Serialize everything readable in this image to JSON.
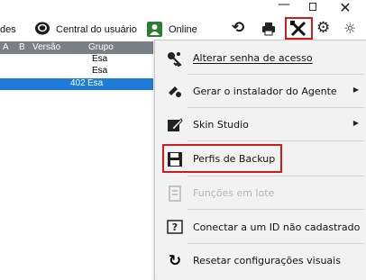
{
  "window": {
    "minimize_glyph": "—",
    "close_glyph": "✕"
  },
  "toolbar": {
    "left_partial_label": "des",
    "central_label": "Central do usuário",
    "online_label": "Online",
    "icons": [
      "chat-icon",
      "online-status-icon",
      "refresh-icon",
      "print-icon",
      "tools-icon",
      "gear-icon",
      "bulb-icon"
    ],
    "highlight_color": "#d11a1a"
  },
  "grid": {
    "columns": [
      "A",
      "B",
      "Versão",
      "Grupo"
    ],
    "rows": [
      {
        "version": "",
        "group": "Esa",
        "selected": false
      },
      {
        "version": "",
        "group": "Esa",
        "selected": false
      },
      {
        "version": "402",
        "group": "Esa",
        "selected": true
      }
    ],
    "header_color": "#7b7f86",
    "selected_color": "#1e7bd6"
  },
  "menu": {
    "items": [
      {
        "label": "Alterar senha de acesso",
        "icon": "password-key-icon",
        "submenu": false,
        "disabled": false
      },
      {
        "label": "Gerar o instalador do Agente",
        "icon": "installer-icon",
        "submenu": true,
        "disabled": false
      },
      {
        "label": "Skin Studio",
        "icon": "skin-brush-icon",
        "submenu": true,
        "disabled": false
      },
      {
        "label": "Perfis de Backup",
        "icon": "floppy-disk-icon",
        "submenu": false,
        "disabled": false,
        "highlighted": true
      },
      {
        "label": "Funções em lote",
        "icon": "batch-document-icon",
        "submenu": false,
        "disabled": true
      },
      {
        "label": "Conectar a um ID não cadastrado",
        "icon": "question-box-icon",
        "submenu": false,
        "disabled": false
      },
      {
        "label": "Resetar configurações visuais",
        "icon": "reset-icon",
        "submenu": false,
        "disabled": false
      }
    ]
  }
}
